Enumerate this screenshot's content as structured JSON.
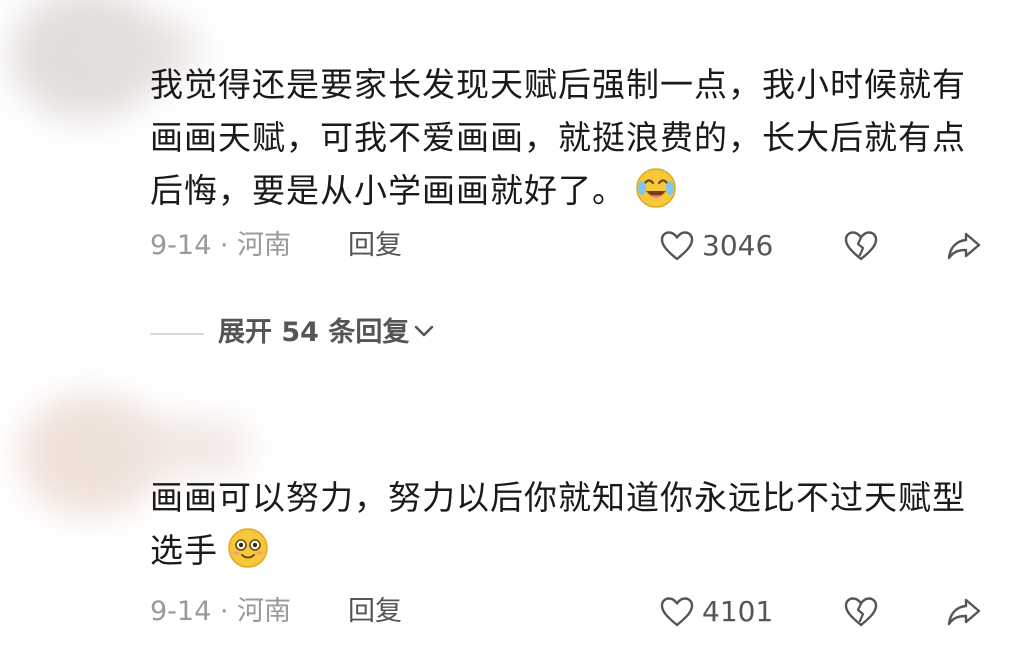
{
  "comments": [
    {
      "text": "我觉得还是要家长发现天赋后强制一点，我小时候就有画画天赋，可我不爱画画，就挺浪费的，长大后就有点后悔，要是从小学画画就好了。",
      "emoji": "crying-laughing-emoji",
      "date_location": "9-14 · 河南",
      "reply_label": "回复",
      "like_count": "3046"
    },
    {
      "text": "画画可以努力，努力以后你就知道你永远比不过天赋型选手",
      "emoji": "smiling-emoji",
      "date_location": "9-14 · 河南",
      "reply_label": "回复",
      "like_count": "4101"
    }
  ],
  "expand_replies": {
    "label": "展开 54 条回复"
  },
  "colors": {
    "text": "#1a1a1a",
    "meta": "#9a9a9a",
    "action": "#555555",
    "emoji_yellow": "#f7c93a"
  },
  "icons": [
    "heart-icon",
    "broken-heart-icon",
    "share-icon",
    "chevron-down-icon"
  ]
}
